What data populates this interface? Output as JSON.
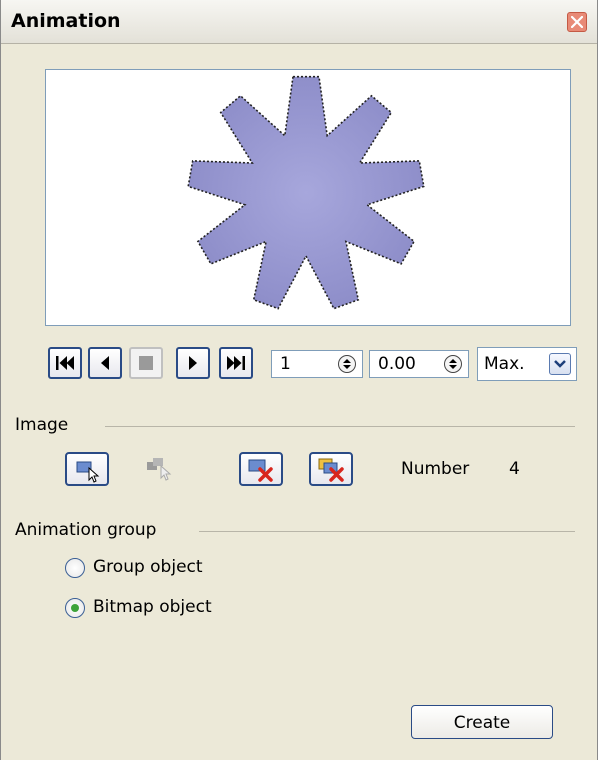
{
  "window": {
    "title": "Animation"
  },
  "icons": {
    "close": "close-icon",
    "first": "first-image-icon",
    "backwards": "play-backwards-icon",
    "stop": "stop-icon",
    "play": "play-icon",
    "last": "last-image-icon",
    "apply_object": "apply-object-icon",
    "apply_objects_individually": "apply-objects-individually-icon",
    "delete_current_image": "delete-current-image-icon",
    "delete_all_images": "delete-all-images-icon",
    "dropdown": "chevron-down-icon",
    "spin": "spin-arrows-icon"
  },
  "preview": {
    "shape": "star",
    "fill_color": "#9b9bd3"
  },
  "playback": {
    "image_number": "1",
    "duration": "0.00",
    "loop_count": "Max."
  },
  "image_section": {
    "label": "Image",
    "number_label": "Number",
    "number_value": "4"
  },
  "animation_group": {
    "label": "Animation group",
    "options": [
      {
        "label": "Group object",
        "selected": false
      },
      {
        "label": "Bitmap object",
        "selected": true
      }
    ]
  },
  "create_label": "Create",
  "colors": {
    "accent": "#2a4b86",
    "close": "#e88a76",
    "radio_dot": "#3da33a"
  }
}
